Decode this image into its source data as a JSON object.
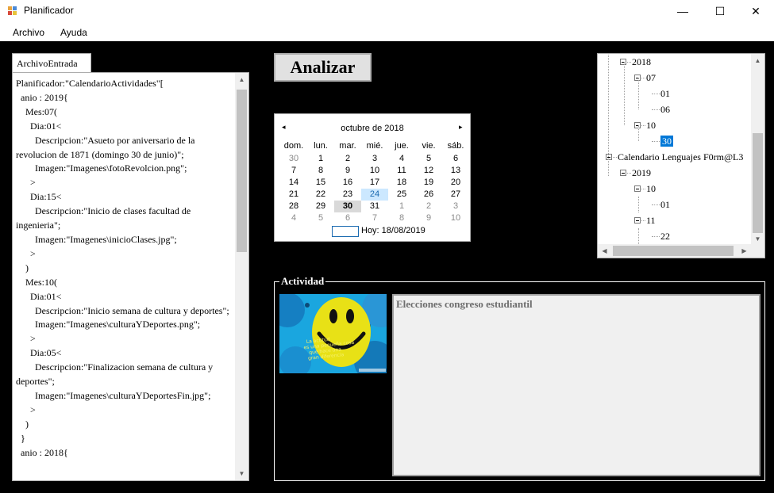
{
  "window": {
    "title": "Planificador",
    "minimize": "—",
    "maximize": "☐",
    "close": "✕"
  },
  "menu": {
    "archivo": "Archivo",
    "ayuda": "Ayuda"
  },
  "editor": {
    "tab_label": "ArchivoEntrada",
    "lines": [
      "Planificador:\"CalendarioActividades\"[",
      "  anio : 2019{",
      "    Mes:07(",
      "      Dia:01<",
      "        Descripcion:\"Asueto por aniversario de la revolucion de 1871 (domingo 30 de junio)\";",
      "        Imagen:\"Imagenes\\fotoRevolcion.png\";",
      "      >",
      "      Dia:15<",
      "        Descripcion:\"Inicio de clases facultad de ingenieria\";",
      "        Imagen:\"Imagenes\\inicioClases.jpg\";",
      "      >",
      "    )",
      "    Mes:10(",
      "      Dia:01<",
      "        Descripcion:\"Inicio semana de cultura y deportes\";",
      "        Imagen:\"Imagenes\\culturaYDeportes.png\";",
      "      >",
      "      Dia:05<",
      "        Descripcion:\"Finalizacion semana de cultura y deportes\";",
      "        Imagen:\"Imagenes\\culturaYDeportesFin.jpg\";",
      "      >",
      "    )",
      "  }",
      "  anio : 2018{"
    ]
  },
  "analyze_button": "Analizar",
  "calendar": {
    "month_label": "octubre de 2018",
    "prev": "◂",
    "next": "▸",
    "weekdays": [
      "dom.",
      "lun.",
      "mar.",
      "mié.",
      "jue.",
      "vie.",
      "sáb."
    ],
    "weeks": [
      [
        "30",
        "1",
        "2",
        "3",
        "4",
        "5",
        "6"
      ],
      [
        "7",
        "8",
        "9",
        "10",
        "11",
        "12",
        "13"
      ],
      [
        "14",
        "15",
        "16",
        "17",
        "18",
        "19",
        "20"
      ],
      [
        "21",
        "22",
        "23",
        "24",
        "25",
        "26",
        "27"
      ],
      [
        "28",
        "29",
        "30",
        "31",
        "1",
        "2",
        "3"
      ],
      [
        "4",
        "5",
        "6",
        "7",
        "8",
        "9",
        "10"
      ]
    ],
    "selected_day": "30",
    "highlighted_day": "24",
    "today_label": "Hoy: 18/08/2019"
  },
  "tree": {
    "nodes": [
      {
        "label": "2018",
        "level": 1,
        "expanded": true
      },
      {
        "label": "07",
        "level": 2,
        "expanded": true
      },
      {
        "label": "01",
        "level": 3
      },
      {
        "label": "06",
        "level": 3
      },
      {
        "label": "10",
        "level": 2,
        "expanded": true
      },
      {
        "label": "30",
        "level": 3,
        "selected": true
      },
      {
        "label": "Calendario Lenguajes F0rm@L3",
        "level": 0,
        "expanded": true
      },
      {
        "label": "2019",
        "level": 1,
        "expanded": true
      },
      {
        "label": "10",
        "level": 2,
        "expanded": true
      },
      {
        "label": "01",
        "level": 3
      },
      {
        "label": "11",
        "level": 2,
        "expanded": true
      },
      {
        "label": "22",
        "level": 3
      }
    ]
  },
  "activity": {
    "group_label": "Actividad",
    "description": "Elecciones congreso estudiantil",
    "image_caption": "La actitud es una pequeña cosa que hace una gran diferencia"
  }
}
